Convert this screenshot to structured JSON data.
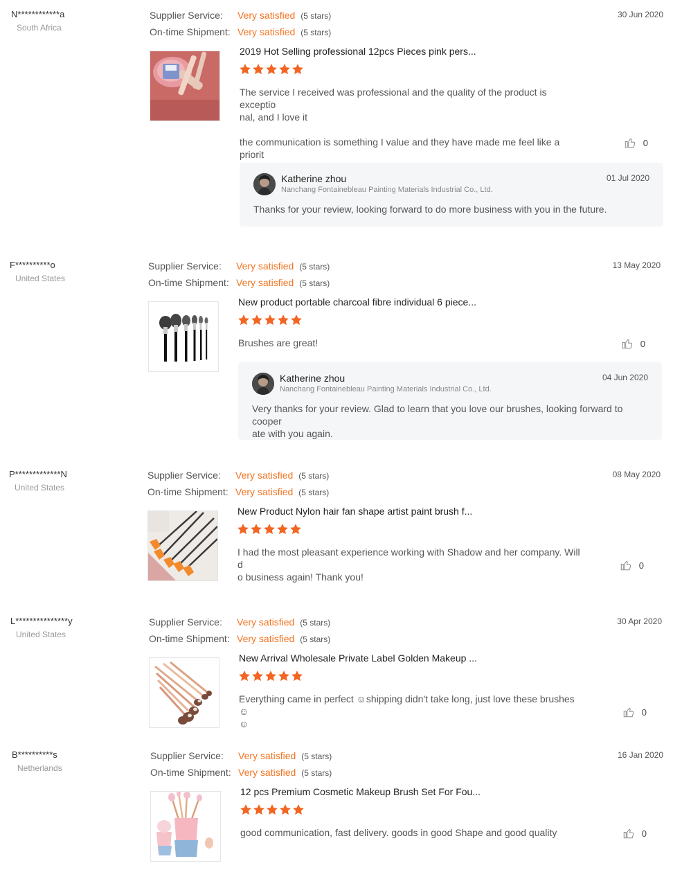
{
  "labels": {
    "supplier_service": "Supplier Service:",
    "ontime_shipment": "On-time Shipment:"
  },
  "colors": {
    "accent": "#f27523",
    "star": "#f26522"
  },
  "reviews": [
    {
      "buyer": "N************a",
      "country": "South Africa",
      "supplier_service": "Very satisfied",
      "supplier_service_stars": "(5 stars)",
      "ontime_shipment": "Very satisfied",
      "ontime_shipment_stars": "(5 stars)",
      "date": "30 Jun 2020",
      "product_title": "2019 Hot Selling professional 12pcs Pieces pink pers...",
      "product_image": "pink-brush-set-image",
      "rating": 5,
      "comment": [
        "The service I received was professional and the quality of the product is exceptio\nnal, and I love it",
        "the communication is something I value and they have made me feel like a priorit\ny, I am very happy and satisfied with the overall process and products"
      ],
      "likes": "0",
      "reply": {
        "name": "Katherine zhou",
        "company": "Nanchang Fontainebleau Painting Materials Industrial Co., Ltd.",
        "date": "01 Jul 2020",
        "text": "Thanks for your review, looking forward to do more business with you in the future."
      }
    },
    {
      "buyer": "F**********o",
      "country": "United States",
      "supplier_service": "Very satisfied",
      "supplier_service_stars": "(5 stars)",
      "ontime_shipment": "Very satisfied",
      "ontime_shipment_stars": "(5 stars)",
      "date": "13 May 2020",
      "product_title": "New product portable charcoal fibre individual 6 piece...",
      "product_image": "black-brush-set-image",
      "rating": 5,
      "comment": [
        "Brushes are great!"
      ],
      "likes": "0",
      "reply": {
        "name": "Katherine zhou",
        "company": "Nanchang Fontainebleau Painting Materials Industrial Co., Ltd.",
        "date": "04 Jun 2020",
        "text": "Very thanks for your review. Glad to learn that you love our brushes, looking forward to cooper\nate with you again."
      }
    },
    {
      "buyer": "P*************N",
      "country": "United States",
      "supplier_service": "Very satisfied",
      "supplier_service_stars": "(5 stars)",
      "ontime_shipment": "Very satisfied",
      "ontime_shipment_stars": "(5 stars)",
      "date": "08 May 2020",
      "product_title": "New Product Nylon hair fan shape artist paint brush f...",
      "product_image": "fan-brush-set-image",
      "rating": 5,
      "comment": [
        "I had the most pleasant experience working with Shadow and her company. Will d\no business again! Thank you!"
      ],
      "likes": "0"
    },
    {
      "buyer": "L***************y",
      "country": "United States",
      "supplier_service": "Very satisfied",
      "supplier_service_stars": "(5 stars)",
      "ontime_shipment": "Very satisfied",
      "ontime_shipment_stars": "(5 stars)",
      "date": "30 Apr 2020",
      "product_title": "New Arrival Wholesale Private Label Golden Makeup ...",
      "product_image": "golden-brush-set-image",
      "rating": 5,
      "comment": [
        "Everything came in perfect ☺shipping didn't take long, just love these brushes ☺\n☺"
      ],
      "likes": "0"
    },
    {
      "buyer": "B**********s",
      "country": "Netherlands",
      "supplier_service": "Very satisfied",
      "supplier_service_stars": "(5 stars)",
      "ontime_shipment": "Very satisfied",
      "ontime_shipment_stars": "(5 stars)",
      "date": "16 Jan 2020",
      "product_title": "12 pcs Premium Cosmetic Makeup Brush Set For Fou...",
      "product_image": "pink-cup-brush-set-image",
      "rating": 5,
      "comment": [
        "good communication, fast delivery. goods in good Shape and good quality"
      ],
      "likes": "0"
    }
  ]
}
